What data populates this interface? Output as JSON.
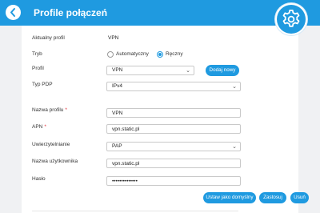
{
  "header": {
    "title": "Profile połączeń"
  },
  "form": {
    "current_profile": {
      "label": "Aktualny profil",
      "value": "VPN"
    },
    "mode": {
      "label": "Tryb",
      "options": [
        {
          "label": "Automatyczny",
          "selected": false
        },
        {
          "label": "Ręczny",
          "selected": true
        }
      ]
    },
    "profile": {
      "label": "Profil",
      "value": "VPN",
      "add_button": "Dodaj nowy"
    },
    "pdp_type": {
      "label": "Typ PDP",
      "value": "IPv4"
    },
    "profile_name": {
      "label": "Nazwa profilu",
      "required_mark": "*",
      "value": "VPN"
    },
    "apn": {
      "label": "APN",
      "required_mark": "*",
      "value": "vpn.static.pl"
    },
    "auth": {
      "label": "Uwierzytelnianie",
      "value": "PAP"
    },
    "username": {
      "label": "Nazwa użytkownika",
      "value": "vpn.static.pl"
    },
    "password": {
      "label": "Hasło",
      "value": "••••••••••••••"
    }
  },
  "actions": {
    "set_default": "Ustaw jako domyślny",
    "apply": "Zastosuj",
    "delete": "Usuń"
  },
  "colors": {
    "accent": "#1f9ae0",
    "required": "#e0303a"
  }
}
